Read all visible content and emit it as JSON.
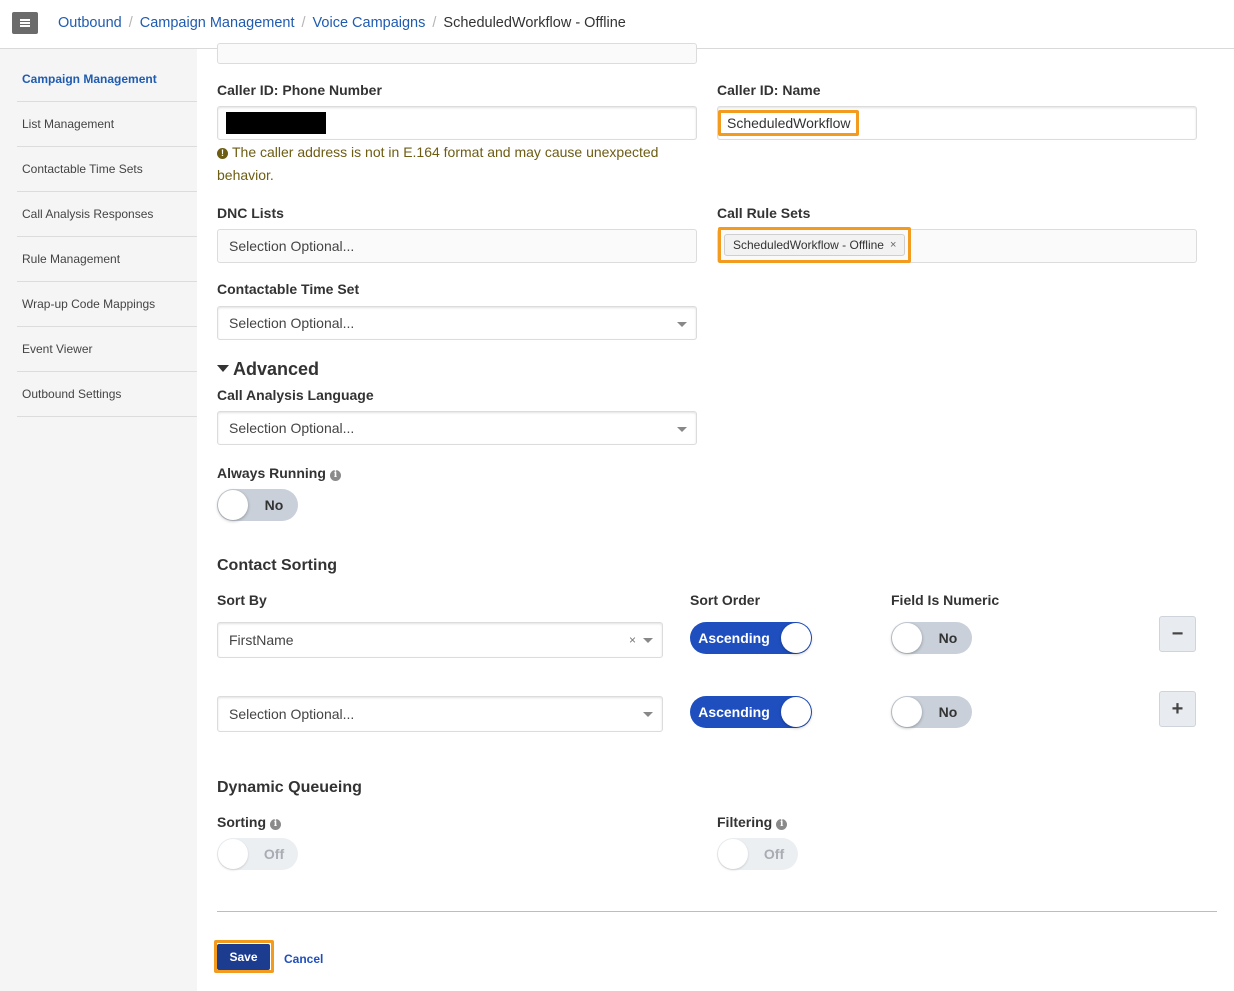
{
  "breadcrumb": {
    "items": [
      "Outbound",
      "Campaign Management",
      "Voice Campaigns"
    ],
    "current": "ScheduledWorkflow - Offline",
    "separator": "/"
  },
  "sidebar": {
    "items": [
      {
        "label": "Campaign Management",
        "active": true
      },
      {
        "label": "List Management"
      },
      {
        "label": "Contactable Time Sets"
      },
      {
        "label": "Call Analysis Responses"
      },
      {
        "label": "Rule Management"
      },
      {
        "label": "Wrap-up Code Mappings"
      },
      {
        "label": "Event Viewer"
      },
      {
        "label": "Outbound Settings"
      }
    ]
  },
  "form": {
    "caller_id_phone": {
      "label": "Caller ID: Phone Number",
      "value": ""
    },
    "caller_id_name": {
      "label": "Caller ID: Name",
      "value": "ScheduledWorkflow"
    },
    "warning": "The caller address is not in E.164 format and may cause unexpected behavior.",
    "dnc_lists": {
      "label": "DNC Lists",
      "placeholder": "Selection Optional..."
    },
    "call_rule_sets": {
      "label": "Call Rule Sets",
      "tag": "ScheduledWorkflow - Offline",
      "tag_remove": "×"
    },
    "contactable_time_set": {
      "label": "Contactable Time Set",
      "placeholder": "Selection Optional..."
    },
    "advanced": {
      "title": "Advanced"
    },
    "call_analysis_language": {
      "label": "Call Analysis Language",
      "placeholder": "Selection Optional..."
    },
    "always_running": {
      "label": "Always Running",
      "toggle": "No"
    },
    "contact_sorting": {
      "title": "Contact Sorting",
      "sort_by_label": "Sort By",
      "sort_order_label": "Sort Order",
      "field_numeric_label": "Field Is Numeric",
      "rows": [
        {
          "sort_by": "FirstName",
          "clear": "×",
          "order": "Ascending",
          "numeric": "No",
          "action": "−"
        },
        {
          "sort_by": "Selection Optional...",
          "order": "Ascending",
          "numeric": "No",
          "action": "+"
        }
      ]
    },
    "dynamic_queueing": {
      "title": "Dynamic Queueing",
      "sorting_label": "Sorting",
      "sorting_toggle": "Off",
      "filtering_label": "Filtering",
      "filtering_toggle": "Off"
    }
  },
  "actions": {
    "save": "Save",
    "cancel": "Cancel"
  },
  "colors": {
    "link": "#1f5cb0",
    "toggle_on": "#1f4fbf",
    "highlight": "#f39b1e",
    "save_bg": "#1c3d8f"
  }
}
